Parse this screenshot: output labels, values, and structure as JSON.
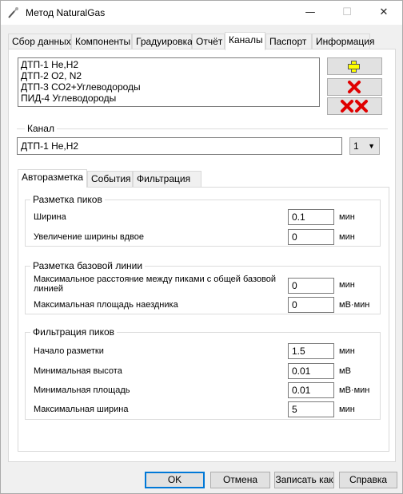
{
  "window": {
    "title": "Метод NaturalGas",
    "minimize": "—",
    "maximize": "☐",
    "close": "✕"
  },
  "tabs": [
    {
      "label": "Сбор данных"
    },
    {
      "label": "Компоненты"
    },
    {
      "label": "Градуировка"
    },
    {
      "label": "Отчёт"
    },
    {
      "label": "Каналы",
      "active": true
    },
    {
      "label": "Паспорт"
    },
    {
      "label": "Информация"
    }
  ],
  "channels": {
    "items": [
      "ДТП-1 He,H2",
      "ДТП-2 O2, N2",
      "ДТП-3 CO2+Углеводороды",
      "ПИД-4 Углеводороды"
    ],
    "add_icon": "plus-icon",
    "delete_icon": "cross-icon",
    "delete_all_icon": "double-cross-icon"
  },
  "channel": {
    "legend": "Канал",
    "name": "ДТП-1 He,H2",
    "number": "1"
  },
  "subtabs": [
    {
      "label": "Авторазметка",
      "active": true
    },
    {
      "label": "События"
    },
    {
      "label": "Фильтрация"
    }
  ],
  "peak_markup": {
    "legend": "Разметка пиков",
    "width_label": "Ширина",
    "width_value": "0.1",
    "width_unit": "мин",
    "double_label": "Увеличение ширины вдвое",
    "double_value": "0",
    "double_unit": "мин"
  },
  "baseline": {
    "legend": "Разметка базовой линии",
    "maxdist_label_1": "Максимальное расстояние между  пиками с общей базовой",
    "maxdist_label_2": "линией",
    "maxdist_value": "0",
    "maxdist_unit": "мин",
    "rider_label": "Максимальная площадь наездника",
    "rider_value": "0",
    "rider_unit": "мВ·мин"
  },
  "filter": {
    "legend": "Фильтрация пиков",
    "start_label": "Начало разметки",
    "start_value": "1.5",
    "start_unit": "мин",
    "height_label": "Минимальная высота",
    "height_value": "0.01",
    "height_unit": "мВ",
    "area_label": "Минимальная площадь",
    "area_value": "0.01",
    "area_unit": "мВ·мин",
    "maxwidth_label": "Максимальная ширина",
    "maxwidth_value": "5",
    "maxwidth_unit": "мин"
  },
  "buttons": {
    "ok": "OK",
    "cancel": "Отмена",
    "save_as": "Записать как",
    "help": "Справка"
  },
  "colors": {
    "accent": "#0078d7",
    "plus": "#ffff00",
    "cross": "#e00000"
  }
}
